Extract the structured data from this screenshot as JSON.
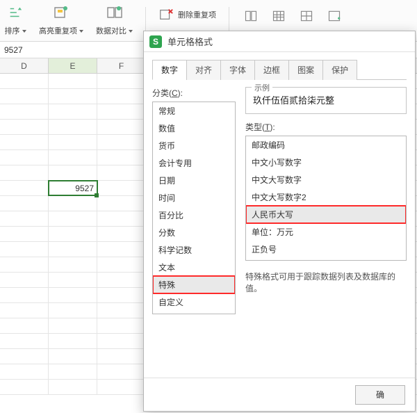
{
  "toolbar": {
    "sort_label": "排序",
    "highlight_dups_label": "高亮重复项",
    "data_compare_label": "数据对比",
    "remove_dups_label": "删除重复项"
  },
  "formula_bar": {
    "value": "9527"
  },
  "grid": {
    "columns": [
      "D",
      "E",
      "F"
    ],
    "active_col_index": 1,
    "active_value": "9527"
  },
  "dialog": {
    "title": "单元格格式",
    "tabs": [
      "数字",
      "对齐",
      "字体",
      "边框",
      "图案",
      "保护"
    ],
    "active_tab": 0,
    "category_label_prefix": "分类(",
    "category_label_accel": "C",
    "category_label_suffix": "):",
    "categories": [
      "常规",
      "数值",
      "货币",
      "会计专用",
      "日期",
      "时间",
      "百分比",
      "分数",
      "科学记数",
      "文本",
      "特殊",
      "自定义"
    ],
    "selected_category_index": 10,
    "sample_legend": "示例",
    "sample_value": "玖仟伍佰贰拾柒元整",
    "type_label_prefix": "类型(",
    "type_label_accel": "T",
    "type_label_suffix": "):",
    "types": [
      "邮政编码",
      "中文小写数字",
      "中文大写数字",
      "中文大写数字2",
      "人民币大写",
      "单位：万元",
      "正负号"
    ],
    "selected_type_index": 4,
    "description": "特殊格式可用于跟踪数据列表及数据库的值。",
    "ok_label": "确"
  }
}
